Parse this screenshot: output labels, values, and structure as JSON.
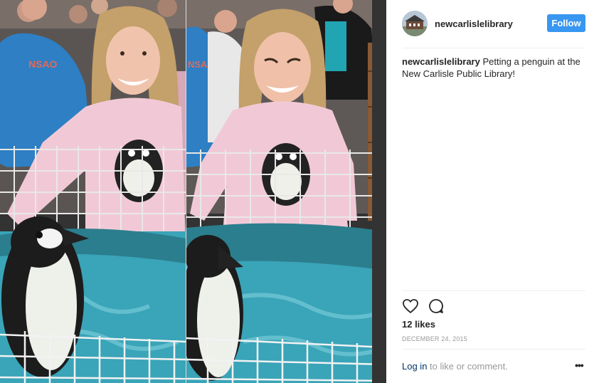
{
  "post": {
    "username": "newcarlislelibrary",
    "follow_label": "Follow",
    "caption_user": "newcarlislelibrary",
    "caption_text": " Petting a penguin at the New Carlisle Public Library!",
    "likes": "12 likes",
    "date": "DECEMBER 24, 2015",
    "login_link": "Log in",
    "login_rest": " to like or comment.",
    "more_label": "•••"
  },
  "icons": {
    "like": "heart-outline-icon",
    "comment": "comment-bubble-icon",
    "more": "more-options-icon"
  },
  "colors": {
    "follow_button": "#3897f0",
    "link": "#003569",
    "muted": "#999999"
  }
}
